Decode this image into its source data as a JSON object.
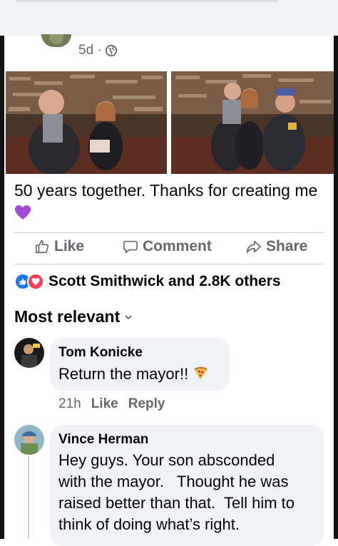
{
  "post": {
    "timestamp": "5d ·",
    "privacy_icon": "globe-icon",
    "caption": "50 years together. Thanks for creating me",
    "caption_emoji": "purple-heart"
  },
  "actions": {
    "like": "Like",
    "comment": "Comment",
    "share": "Share"
  },
  "reactions": {
    "summary": "Scott Smithwick and 2.8K others",
    "icons": [
      "like-icon",
      "love-icon"
    ],
    "colors": {
      "like": "#1877f2",
      "love": "#f33e58"
    }
  },
  "comments_sort": {
    "label": "Most relevant"
  },
  "comments": [
    {
      "name": "Tom Konicke",
      "text": "Return the mayor!!",
      "emoji": "pizza",
      "time": "21h",
      "like": "Like",
      "reply": "Reply"
    },
    {
      "name": "Vince Herman",
      "lines": [
        "Hey guys. Your son absconded",
        "with the mayor.   Thought he was",
        "raised better than that.  Tell him to",
        "think of doing what’s right."
      ]
    }
  ],
  "colors": {
    "secondary_text": "#65676b",
    "bubble": "#f0f2f5",
    "divider": "#ced0d4"
  }
}
